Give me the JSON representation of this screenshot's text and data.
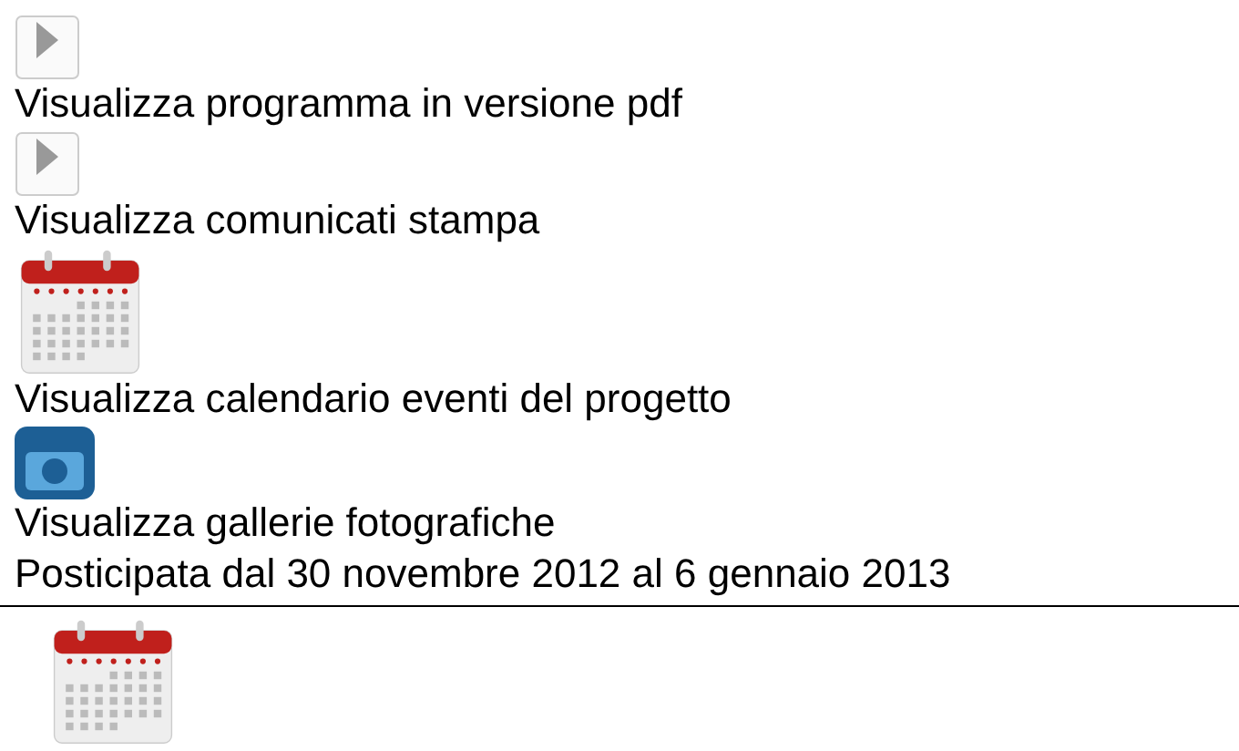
{
  "links": [
    {
      "kind": "play",
      "label": "Visualizza programma in versione pdf"
    },
    {
      "kind": "play",
      "label": "Visualizza comunicati stampa"
    },
    {
      "kind": "calendar",
      "label": "Visualizza calendario eventi del progetto"
    },
    {
      "kind": "camera",
      "label": "Visualizza gallerie fotografiche"
    }
  ],
  "event": {
    "dates": "Posticipata dal 30 novembre 2012 al 6 gennaio 2013"
  }
}
